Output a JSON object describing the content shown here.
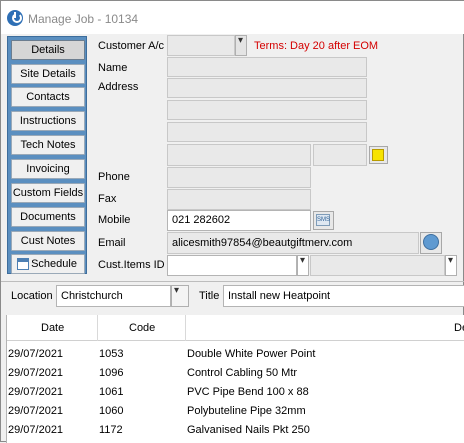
{
  "window": {
    "title": "Manage Job - 10134"
  },
  "nav": {
    "items": [
      {
        "label": "Details",
        "active": true
      },
      {
        "label": "Site Details"
      },
      {
        "label": "Contacts"
      },
      {
        "label": "Instructions"
      },
      {
        "label": "Tech Notes"
      },
      {
        "label": "Invoicing"
      },
      {
        "label": "Custom Fields"
      },
      {
        "label": "Documents"
      },
      {
        "label": "Cust Notes"
      },
      {
        "label": "Schedule",
        "icon": "calendar-icon"
      }
    ]
  },
  "details": {
    "customer_label": "Customer A/c",
    "customer_value": "",
    "terms": "Terms: Day 20 after EOM",
    "name_label": "Name",
    "address_label": "Address",
    "phone_label": "Phone",
    "fax_label": "Fax",
    "mobile_label": "Mobile",
    "mobile_value": "021 282602",
    "email_label": "Email",
    "email_value": "alicesmith97854@beautgiftmerv.com",
    "cust_items_label": "Cust.Items ID"
  },
  "job": {
    "location_label": "Location",
    "location_value": "Christchurch",
    "title_label": "Title",
    "title_value": "Install new Heatpoint"
  },
  "grid": {
    "headers": [
      "Date",
      "Code",
      "De"
    ],
    "rows": [
      [
        "29/07/2021",
        "1053",
        "Double White Power Point"
      ],
      [
        "29/07/2021",
        "1096",
        "Control Cabling 50 Mtr"
      ],
      [
        "29/07/2021",
        "1061",
        "PVC Pipe Bend 100 x 88"
      ],
      [
        "29/07/2021",
        "1060",
        "Polybuteline Pipe 32mm"
      ],
      [
        "29/07/2021",
        "1172",
        "Galvanised Nails Pkt 250"
      ]
    ]
  },
  "colors": {
    "nav_panel": "#5b8fc0",
    "terms_text": "#d40000"
  }
}
